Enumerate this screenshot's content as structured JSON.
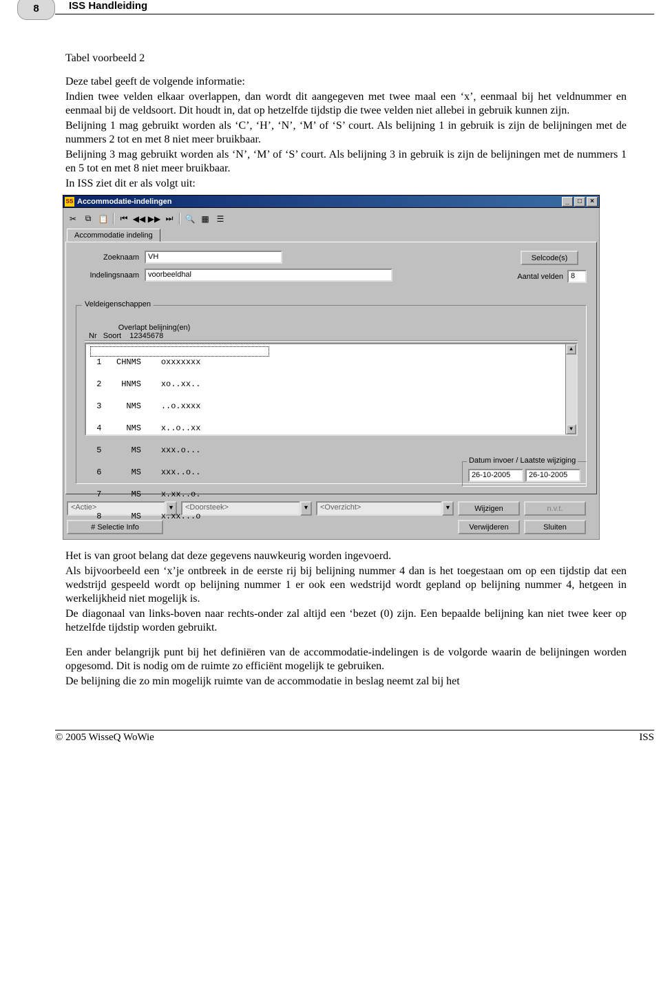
{
  "page": {
    "number": "8",
    "header_title": "ISS Handleiding"
  },
  "text": {
    "title": "Tabel voorbeeld 2",
    "p1": "Deze tabel geeft de volgende informatie:",
    "p2": "Indien twee velden elkaar overlappen, dan wordt dit aangegeven met twee maal een ‘x’, eenmaal bij het veldnummer en eenmaal bij de veldsoort. Dit houdt in, dat op hetzelfde tijdstip die twee velden niet allebei in gebruik kunnen zijn.",
    "p3": "Belijning 1 mag gebruikt worden als ‘C’, ‘H’, ‘N’, ‘M’ of ‘S’ court. Als belijning 1 in gebruik is zijn de belijningen met de nummers 2 tot en met 8 niet meer bruikbaar.",
    "p4": "Belijning 3 mag gebruikt worden als ‘N’, ‘M’ of ‘S’ court. Als belijning 3 in gebruik is zijn de belijningen met de nummers 1 en 5 tot en met 8 niet meer bruikbaar.",
    "p5": "In ISS ziet dit er als volgt uit:",
    "after1": "Het is van groot belang dat deze gegevens nauwkeurig worden ingevoerd.",
    "after2": "Als bijvoorbeeld een ‘x’je ontbreek in de eerste rij bij belijning nummer 4 dan is het toegestaan om op een tijdstip dat een wedstrijd gespeeld wordt op belijning nummer 1 er ook een wedstrijd wordt gepland op belijning nummer 4, hetgeen in werkelijkheid niet mogelijk is.",
    "after3": "De diagonaal van links-boven naar rechts-onder zal altijd een ‘bezet (0) zijn. Een bepaalde belijning kan niet twee keer op hetzelfde tijdstip worden gebruikt.",
    "after4": "Een ander belangrijk punt bij het definiëren van de accommodatie-indelingen is de volgorde waarin de belijningen worden opgesomd. Dit is nodig om de ruimte zo efficiënt mogelijk te gebruiken.",
    "after5": "De belijning die zo min mogelijk ruimte van de accommodatie in beslag neemt zal bij het"
  },
  "app": {
    "title": "Accommodatie-indelingen",
    "icon_text": "SS",
    "tab_label": "Accommodatie indeling",
    "labels": {
      "zoeknaam": "Zoeknaam",
      "indelingsnaam": "Indelingsnaam",
      "selcodes": "Selcode(s)",
      "aantal_velden": "Aantal velden"
    },
    "values": {
      "zoeknaam": "VH",
      "indelingsnaam": "voorbeeldhal",
      "aantal_velden": "8"
    },
    "group": {
      "legend": "Veldeigenschappen",
      "head_line1": "              Overlapt belijning(en)",
      "head_line2": "Nr   Soort    12345678",
      "rows": [
        " 1   CHNMS    oxxxxxxx",
        " 2    HNMS    xo..xx..",
        " 3     NMS    ..o.xxxx",
        " 4     NMS    x..o..xx",
        " 5      MS    xxx.o...",
        " 6      MS    xxx..o..",
        " 7      MS    x.xx..o.",
        " 8      MS    x.xx...o"
      ]
    },
    "dates": {
      "legend": "Datum invoer / Laatste wijziging",
      "invoer": "26-10-2005",
      "wijziging": "26-10-2005"
    },
    "bottom": {
      "actie": "<Actie>",
      "doorsteek": "<Doorsteek>",
      "overzicht": "<Overzicht>",
      "selectie": "# Selectie Info",
      "wijzigen": "Wijzigen",
      "nvt": "n.v.t.",
      "verwijderen": "Verwijderen",
      "sluiten": "Sluiten"
    }
  },
  "footer": {
    "left": "© 2005 WisseQ WoWie",
    "right": "ISS"
  }
}
